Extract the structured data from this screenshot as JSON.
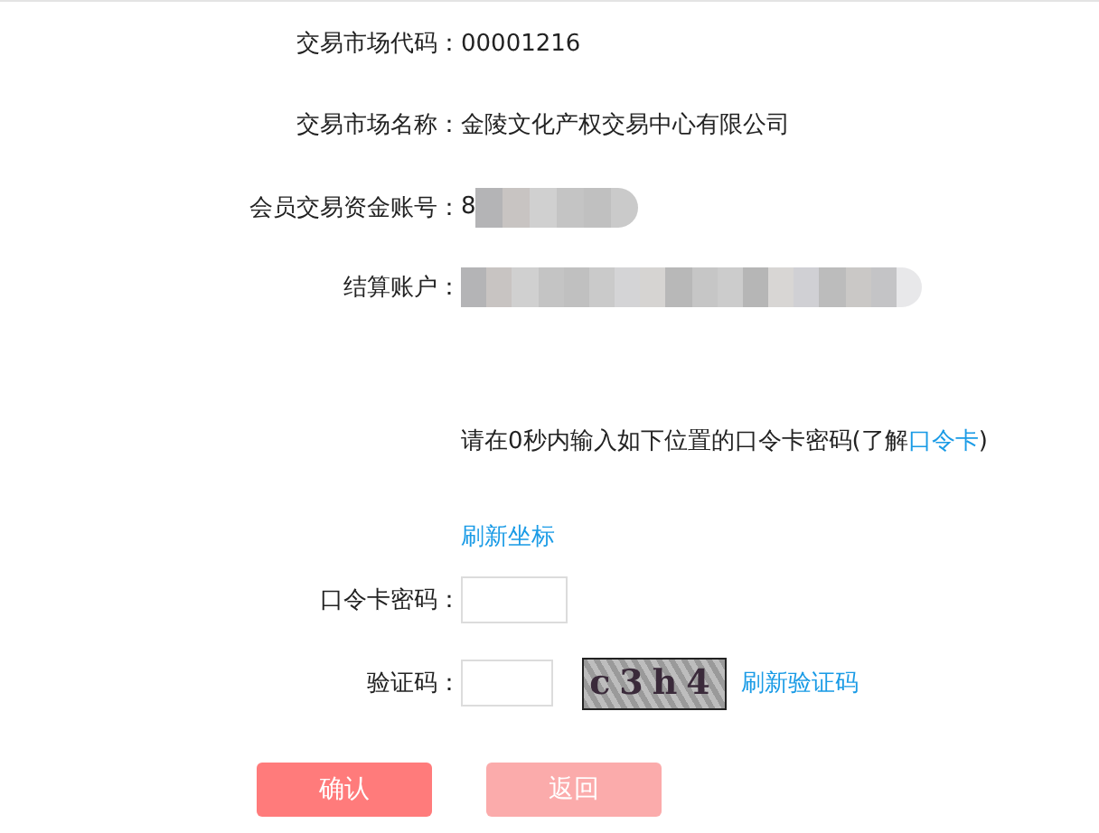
{
  "fields": [
    {
      "label": "交易市场代码：",
      "value": "00001216"
    },
    {
      "label": "交易市场名称：",
      "value": "金陵文化产权交易中心有限公司"
    },
    {
      "label": "会员交易资金账号：",
      "value": "8",
      "redacted": true
    },
    {
      "label": "结算账户：",
      "redacted": true
    }
  ],
  "instruction": {
    "text": "请在0秒内输入如下位置的口令卡密码(了解",
    "link": "口令卡",
    "after": ")"
  },
  "refresh_coords": "刷新坐标",
  "card_password": {
    "label": "口令卡密码："
  },
  "captcha": {
    "label": "验证码：",
    "code": "c3h4",
    "refresh": "刷新验证码"
  },
  "buttons": [
    {
      "label": "确认",
      "disabled": false
    },
    {
      "label": "返回",
      "disabled": true
    }
  ]
}
